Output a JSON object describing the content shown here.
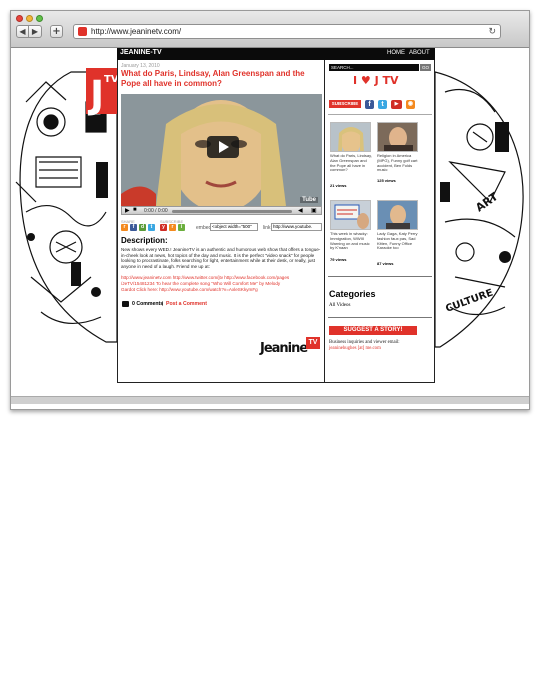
{
  "browser": {
    "url": "http://www.jeaninetv.com/",
    "back_icon": "◀",
    "forward_icon": "▶",
    "new_tab_icon": "+",
    "reload_icon": "↻"
  },
  "site": {
    "logo_text": "JEANINE-TV",
    "nav": [
      "HOME",
      "ABOUT"
    ],
    "brand_logo_big": "TV",
    "footer_logo": "Jeanine",
    "footer_logo_tv": "TV",
    "accent_color": "#e0322a"
  },
  "post": {
    "date": "January 13, 2010",
    "title": "What do Paris, Lindsay, Alan Greenspan and the Pope all have in common?",
    "video": {
      "time": "0:00 / 0:00",
      "watermark": "Tube"
    },
    "share_label": "SHARE",
    "subscribe_label": "SUBSCRIBE",
    "embed_label": "embed",
    "embed_value": "<object width=\"500\"",
    "link_label": "link",
    "link_value": "http://www.youtube.",
    "description_heading": "Description:",
    "description_text": "New shows every WED.! JeanineTV is an authentic and humorous web show that offers a tongue-in-cheek look at news, hot topics of the day and music. It is the perfect \"video snack\" for people looking to procrastinate, folks searching for light, entertainment while at their desk, or really, just anyone in need of a laugh. Friend me up at:",
    "links_line_1": "http://www.jeaninetv.com http://www.twitter.com/jtv http://www.facebook.com/pages",
    "links_line_2": "/JeTV/15481234 To hear the complete song \"Who Will Comfort Me\" by Melody",
    "links_line_3": "Gardot Click here: http://www.youtube.com/watch?v=AxleSKkymFg",
    "comments_count": "0 Comments",
    "separator": "|",
    "post_comment": "Post a Comment"
  },
  "sidebar": {
    "search_placeholder": "SEARCH...",
    "search_button": "GO",
    "love_text": "I ♥ J TV",
    "subscribe_button": "SUBSCRIBE",
    "videos": [
      {
        "caption": "What do Paris, Lindsay, Alan Greenspan and the Pope all have in common?",
        "views": "21 views"
      },
      {
        "caption": "Religion in America (MPG), Funny golf cart accident, Ben Folds music",
        "views": "125 views"
      },
      {
        "caption": "This week in whacky: Immigration, WWIII Warning on and music by K'naan",
        "views": "79 views"
      },
      {
        "caption": "Lady Gaga, Katy Perry fashion faux pas, Sad Kitten, Funny Office Karaoke too",
        "views": "87 views"
      }
    ],
    "categories_heading": "Categories",
    "categories": [
      "All Videos"
    ],
    "suggest_button": "SUGGEST A STORY!",
    "contact_label": "Business inquiries and viewer email:",
    "contact_email": "jeaninehughes [at] me.com"
  },
  "decor_words": [
    "ART",
    "CULTURE"
  ]
}
